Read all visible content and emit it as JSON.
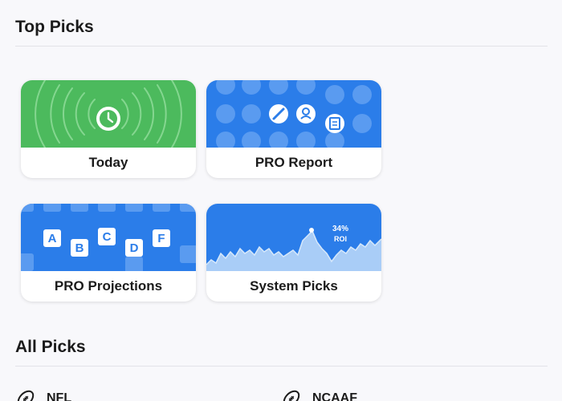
{
  "top_picks": {
    "title": "Top Picks",
    "cards": [
      {
        "label": "Today",
        "icon": "clock-icon",
        "color": "#4cba5d"
      },
      {
        "label": "PRO Report",
        "icon": "pattern-icons",
        "color": "#2b7de9"
      },
      {
        "label": "PRO Projections",
        "icon": "letter-grid",
        "color": "#2b7de9",
        "letters": [
          "A",
          "B",
          "C",
          "D",
          "F"
        ]
      },
      {
        "label": "System Picks",
        "icon": "roi-chart",
        "color": "#2b7de9",
        "roi_value": "34%",
        "roi_label": "ROI"
      }
    ]
  },
  "all_picks": {
    "title": "All Picks",
    "items": [
      {
        "label": "NFL",
        "icon": "football-icon"
      },
      {
        "label": "NCAAF",
        "icon": "football-icon"
      }
    ]
  }
}
